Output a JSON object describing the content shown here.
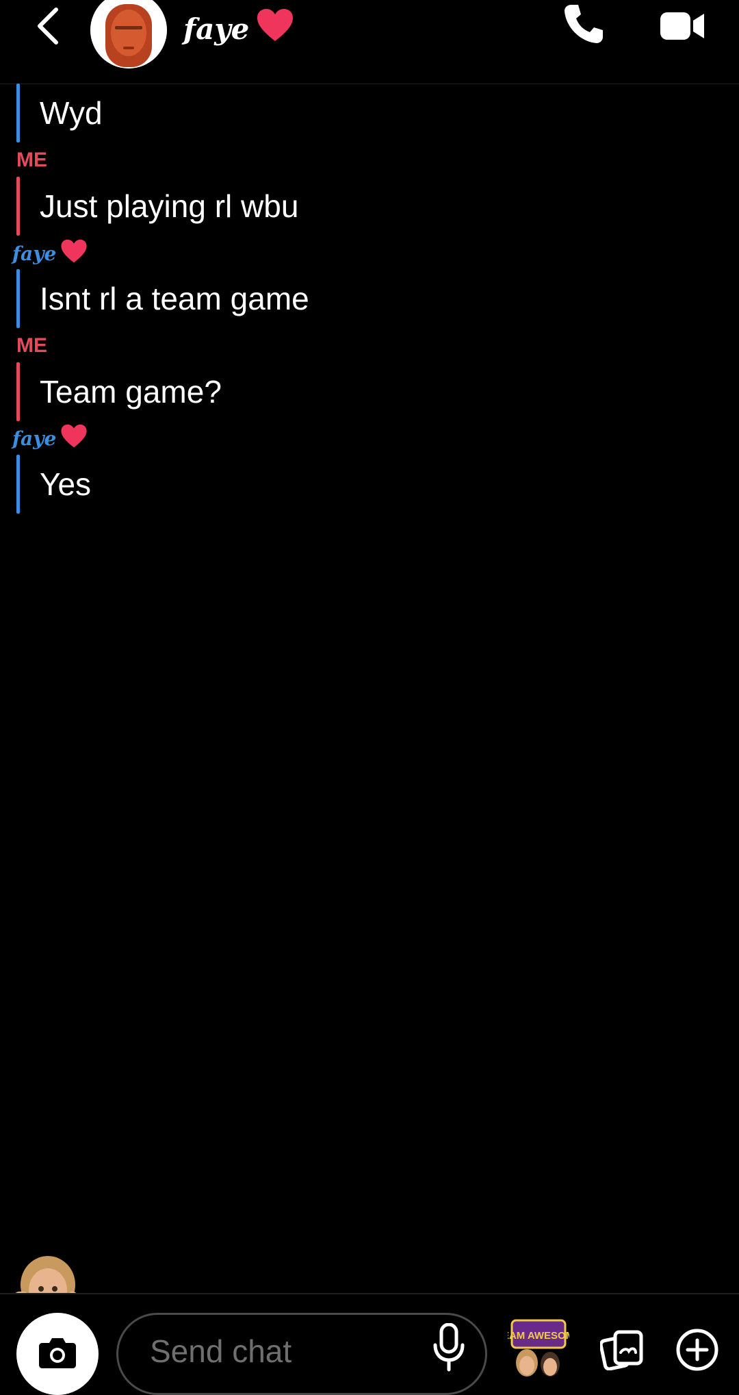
{
  "header": {
    "contact_name": "faye",
    "back_icon": "chevron-left-icon",
    "call_icon": "phone-icon",
    "video_icon": "video-camera-icon"
  },
  "colors": {
    "background": "#000000",
    "me_accent": "#e5495b",
    "friend_accent": "#3c8fe0",
    "heart": "#f0355c"
  },
  "messages": [
    {
      "sender": "",
      "text": "Wyd",
      "side": "friend"
    },
    {
      "sender": "ME",
      "text": "Just playing rl wbu",
      "side": "me"
    },
    {
      "sender": "faye",
      "text": "Isnt rl a team game",
      "side": "friend"
    },
    {
      "sender": "ME",
      "text": "Team game?",
      "side": "me"
    },
    {
      "sender": "faye",
      "text": "Yes",
      "side": "friend"
    }
  ],
  "composer": {
    "placeholder": "Send chat",
    "camera_icon": "camera-icon",
    "mic_icon": "microphone-icon",
    "sticker_text": "TEAM AWESOME",
    "memories_icon": "memories-icon",
    "plus_icon": "plus-circle-icon"
  }
}
